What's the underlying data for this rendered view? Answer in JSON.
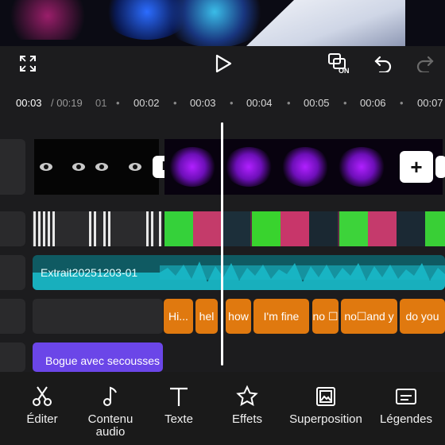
{
  "playback": {
    "current_time": "00:03",
    "total_time": "/ 00:19",
    "ticks": [
      "01",
      "00:02",
      "00:03",
      "00:04",
      "00:05",
      "00:06",
      "00:07"
    ],
    "toggle_badge": "ON"
  },
  "tracks": {
    "audio_label": "Extrait20251203-01",
    "captions": [
      "Hi...",
      "hel",
      "how",
      "I'm fine",
      "no ☐",
      "no☐and y",
      "do you"
    ],
    "effect_label": "Bogue avec secousses",
    "add_symbol": "+",
    "split_symbol": "I"
  },
  "toolbar": {
    "items": [
      {
        "label": "Éditer",
        "icon": "scissors-icon"
      },
      {
        "label": "Contenu audio",
        "icon": "music-note-icon"
      },
      {
        "label": "Texte",
        "icon": "text-icon"
      },
      {
        "label": "Effets",
        "icon": "sparkle-star-icon"
      },
      {
        "label": "Superposition",
        "icon": "overlay-image-icon"
      },
      {
        "label": "Légendes",
        "icon": "captions-icon"
      }
    ]
  },
  "colors": {
    "caption_clip": "#e0790f",
    "audio_clip": "#0f5a62",
    "effect_clip": "#6b46e8",
    "background": "#1c1c1e"
  }
}
